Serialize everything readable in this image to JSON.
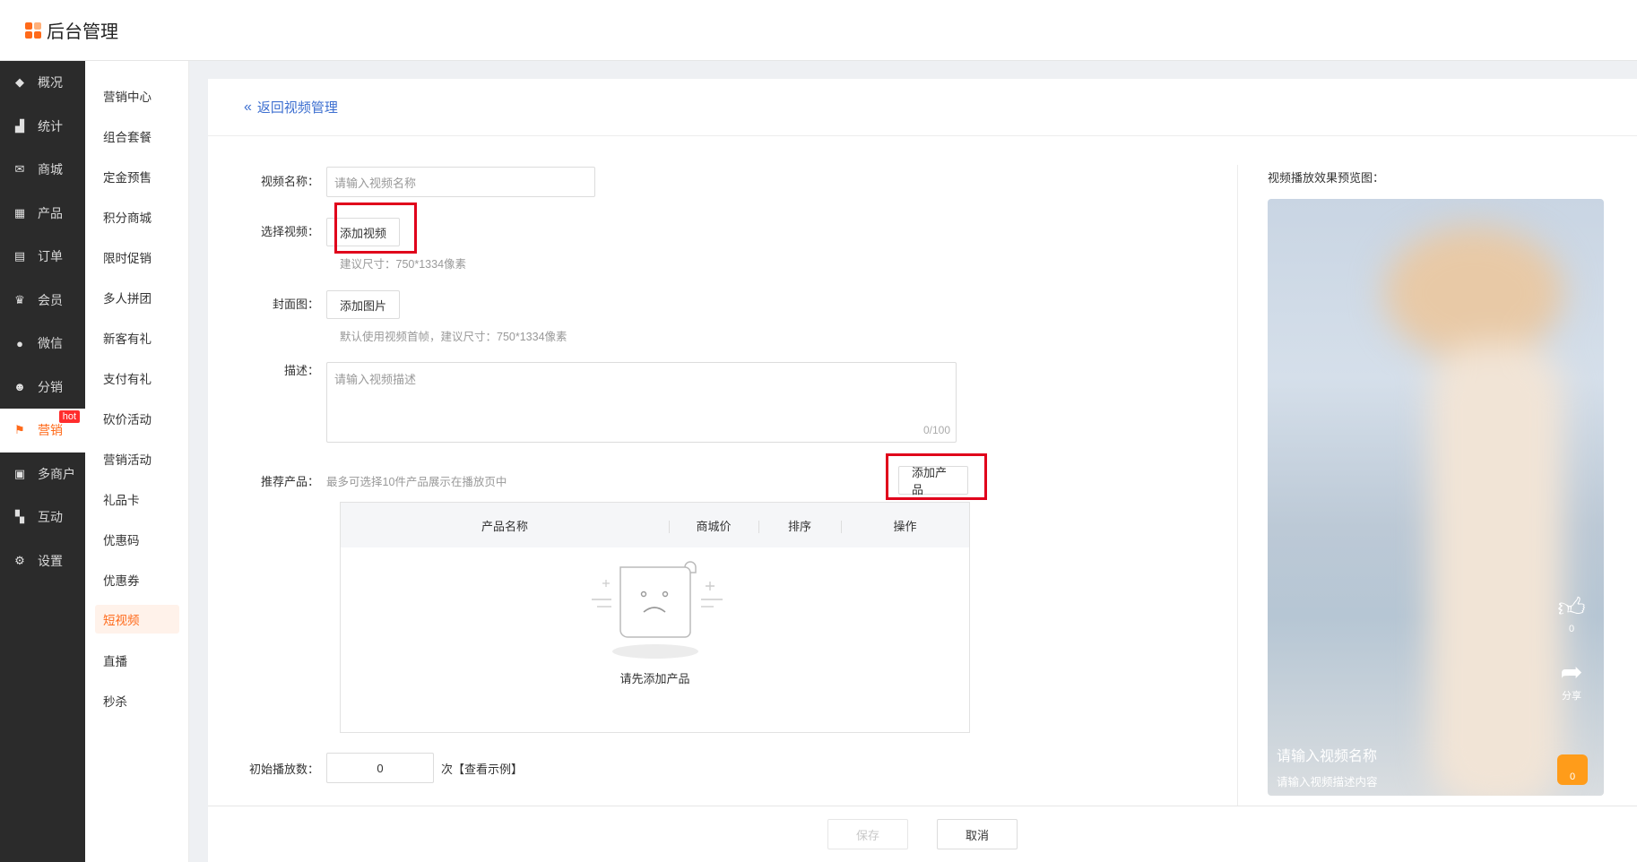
{
  "header": {
    "title": "后台管理",
    "logo_icon": "grid-logo-icon"
  },
  "nav": {
    "items": [
      {
        "label": "概况",
        "icon": "layers-icon"
      },
      {
        "label": "统计",
        "icon": "chart-icon"
      },
      {
        "label": "商城",
        "icon": "mail-icon"
      },
      {
        "label": "产品",
        "icon": "apps-icon"
      },
      {
        "label": "订单",
        "icon": "clipboard-icon"
      },
      {
        "label": "会员",
        "icon": "crown-icon"
      },
      {
        "label": "微信",
        "icon": "wechat-icon"
      },
      {
        "label": "分销",
        "icon": "users-icon"
      },
      {
        "label": "营销",
        "icon": "flag-icon",
        "badge": "hot"
      },
      {
        "label": "多商户",
        "icon": "store-icon"
      },
      {
        "label": "互动",
        "icon": "people-icon"
      },
      {
        "label": "设置",
        "icon": "gear-icon"
      }
    ]
  },
  "subnav": {
    "items": [
      "营销中心",
      "组合套餐",
      "定金预售",
      "积分商城",
      "限时促销",
      "多人拼团",
      "新客有礼",
      "支付有礼",
      "砍价活动",
      "营销活动",
      "礼品卡",
      "优惠码",
      "优惠券",
      "短视频",
      "直播",
      "秒杀"
    ],
    "active": "短视频"
  },
  "back": {
    "label": "返回视频管理"
  },
  "form": {
    "name_label": "视频名称：",
    "name_placeholder": "请输入视频名称",
    "video_label": "选择视频：",
    "add_video": "添加视频",
    "video_hint": "建议尺寸：750*1334像素",
    "cover_label": "封面图：",
    "add_image": "添加图片",
    "cover_hint": "默认使用视频首帧，建议尺寸：750*1334像素",
    "desc_label": "描述：",
    "desc_placeholder": "请输入视频描述",
    "desc_count": "0/100",
    "product_label": "推荐产品：",
    "product_hint": "最多可选择10件产品展示在播放页中",
    "add_product": "添加产品",
    "table_headers": [
      "产品名称",
      "商城价",
      "排序",
      "操作"
    ],
    "empty_text": "请先添加产品",
    "plays_label": "初始播放数：",
    "plays_value": "0",
    "plays_suffix": "次",
    "plays_example": "【查看示例】"
  },
  "footer": {
    "save": "保存",
    "cancel": "取消"
  },
  "preview": {
    "label": "视频播放效果预览图：",
    "likes": "0",
    "share": "分享",
    "cart": "0",
    "title": "请输入视频名称",
    "desc": "请输入视频描述内容"
  },
  "colors": {
    "accent": "#ff6a1a",
    "link": "#3d6fd0",
    "highlight": "#e0001b",
    "nav_bg": "#2b2b2b"
  }
}
